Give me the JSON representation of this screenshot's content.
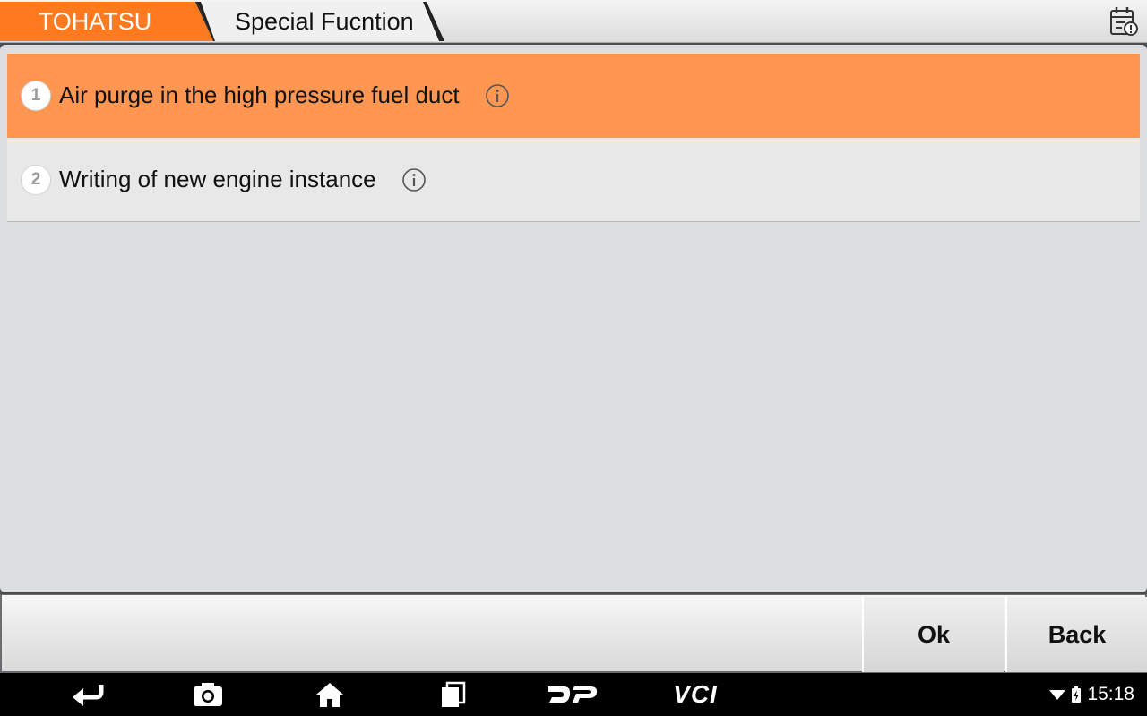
{
  "header": {
    "brand": "TOHATSU",
    "page_title": "Special Fucntion",
    "report_icon": "calendar-alert-icon",
    "brand_color": "#ff7a1f"
  },
  "list": {
    "items": [
      {
        "number": "1",
        "label": "Air purge in the high pressure fuel duct",
        "selected": true
      },
      {
        "number": "2",
        "label": "Writing of new engine instance",
        "selected": false
      }
    ],
    "selected_color": "#ff9652"
  },
  "footer": {
    "ok_label": "Ok",
    "back_label": "Back"
  },
  "navbar": {
    "icons": [
      "back-icon",
      "camera-icon",
      "home-icon",
      "recents-icon",
      "dp-logo-icon",
      "vci-icon"
    ],
    "vci_label": "VCI",
    "dp_label": "DP",
    "time": "15:18"
  }
}
